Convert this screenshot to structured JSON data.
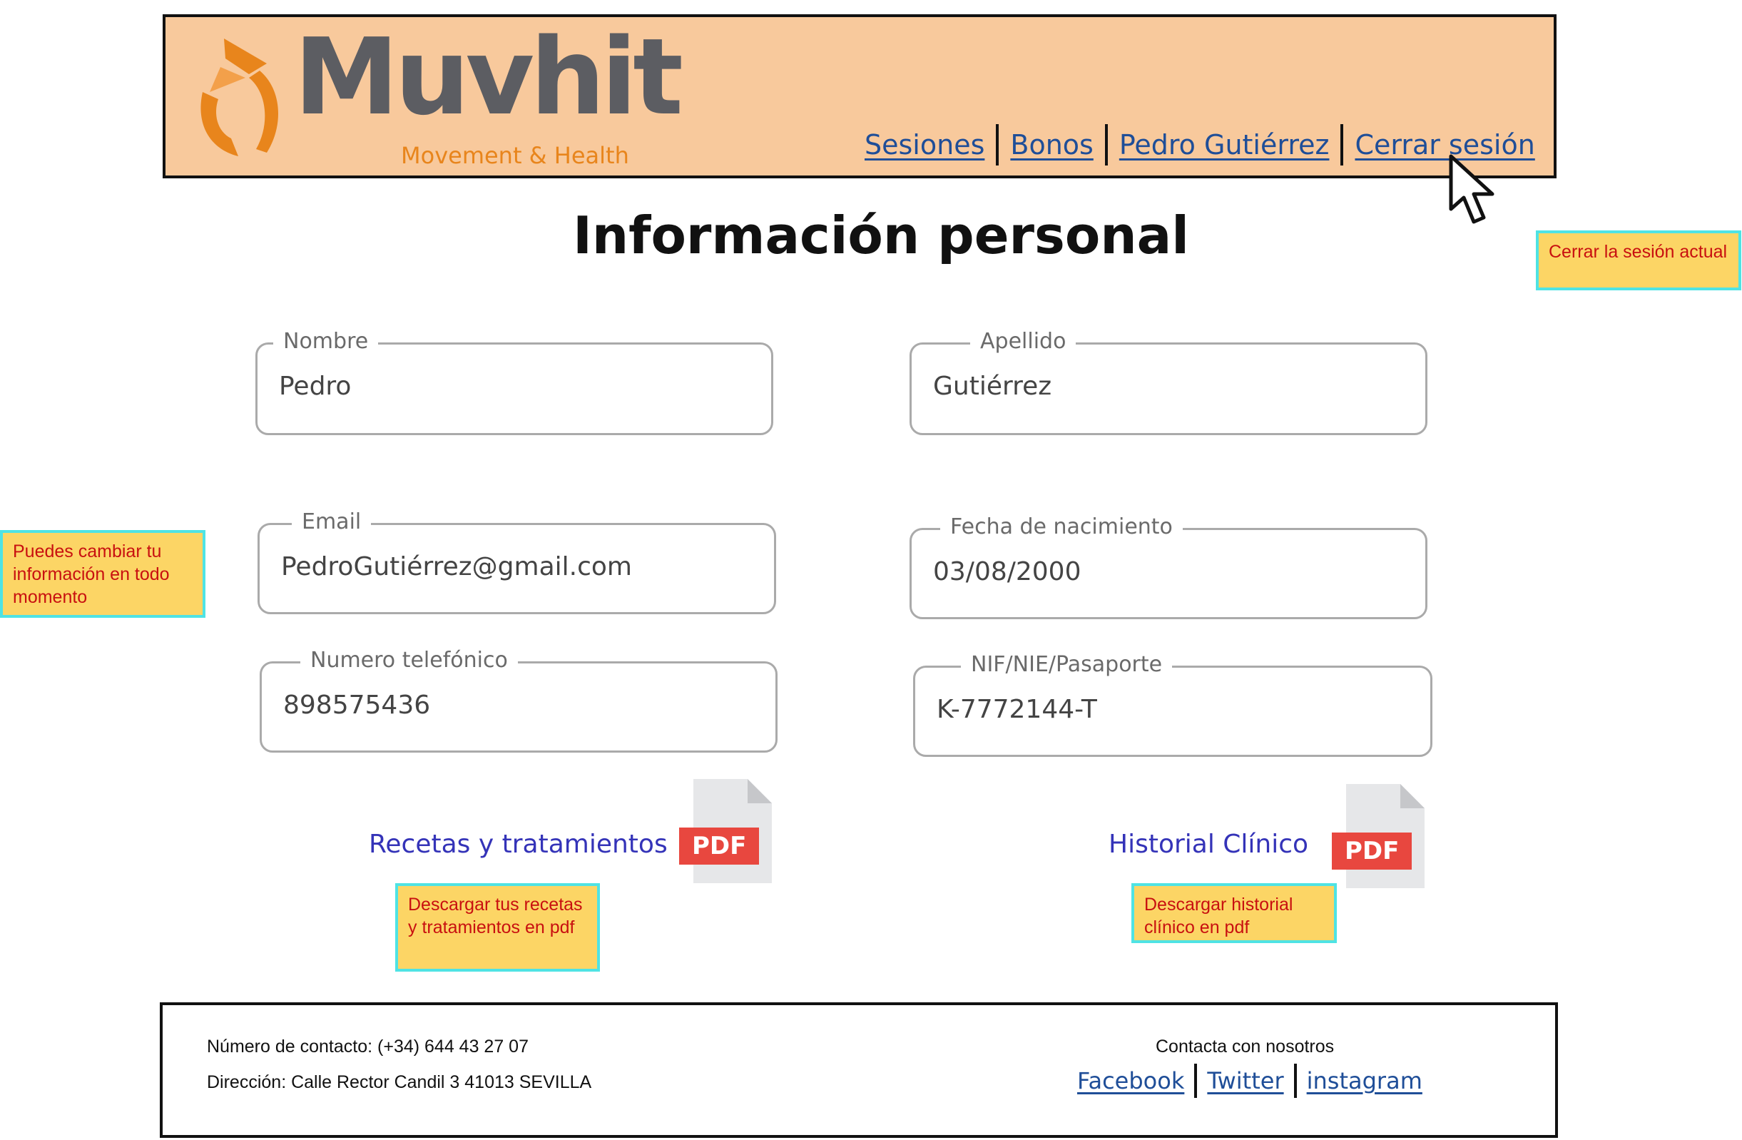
{
  "header": {
    "logo_text": "Muvhit",
    "logo_tagline": "Movement & Health",
    "nav": [
      "Sesiones",
      "Bonos",
      "Pedro Gutiérrez",
      "Cerrar sesión"
    ]
  },
  "page_title": "Información personal",
  "notes": {
    "logout": "Cerrar la sesión actual",
    "edit_info": "Puedes cambiar tu información en todo momento",
    "recipes": "Descargar tus recetas y tratamientos en pdf",
    "history": "Descargar historial clínico en pdf"
  },
  "form": {
    "nombre": {
      "label": "Nombre",
      "value": "Pedro"
    },
    "apellido": {
      "label": "Apellido",
      "value": "Gutiérrez"
    },
    "email": {
      "label": "Email",
      "value": "PedroGutiérrez@gmail.com"
    },
    "fecha": {
      "label": "Fecha de nacimiento",
      "value": "03/08/2000"
    },
    "telefono": {
      "label": "Numero telefónico",
      "value": "898575436"
    },
    "nif": {
      "label": "NIF/NIE/Pasaporte",
      "value": "K-7772144-T"
    }
  },
  "downloads": {
    "recipes_label": "Recetas y tratamientos",
    "history_label": "Historial Clínico",
    "pdf_badge": "PDF"
  },
  "footer": {
    "contact": "Número de contacto:  (+34) 644 43 27 07",
    "address": "Dirección: Calle Rector Candil 3 41013 SEVILLA",
    "contact_us": "Contacta con nosotros",
    "social": [
      "Facebook",
      "Twitter",
      "instagram"
    ]
  },
  "colors": {
    "header_bg": "#f8c99c",
    "brand_orange": "#e8851c",
    "link_blue": "#1f4e98",
    "note_bg": "#fcd565",
    "note_border": "#4fe3e4",
    "note_text": "#c81010",
    "pdf_red": "#e8473f"
  },
  "icons": [
    "muvhit-logo-icon",
    "mouse-cursor-icon",
    "pdf-file-icon"
  ]
}
